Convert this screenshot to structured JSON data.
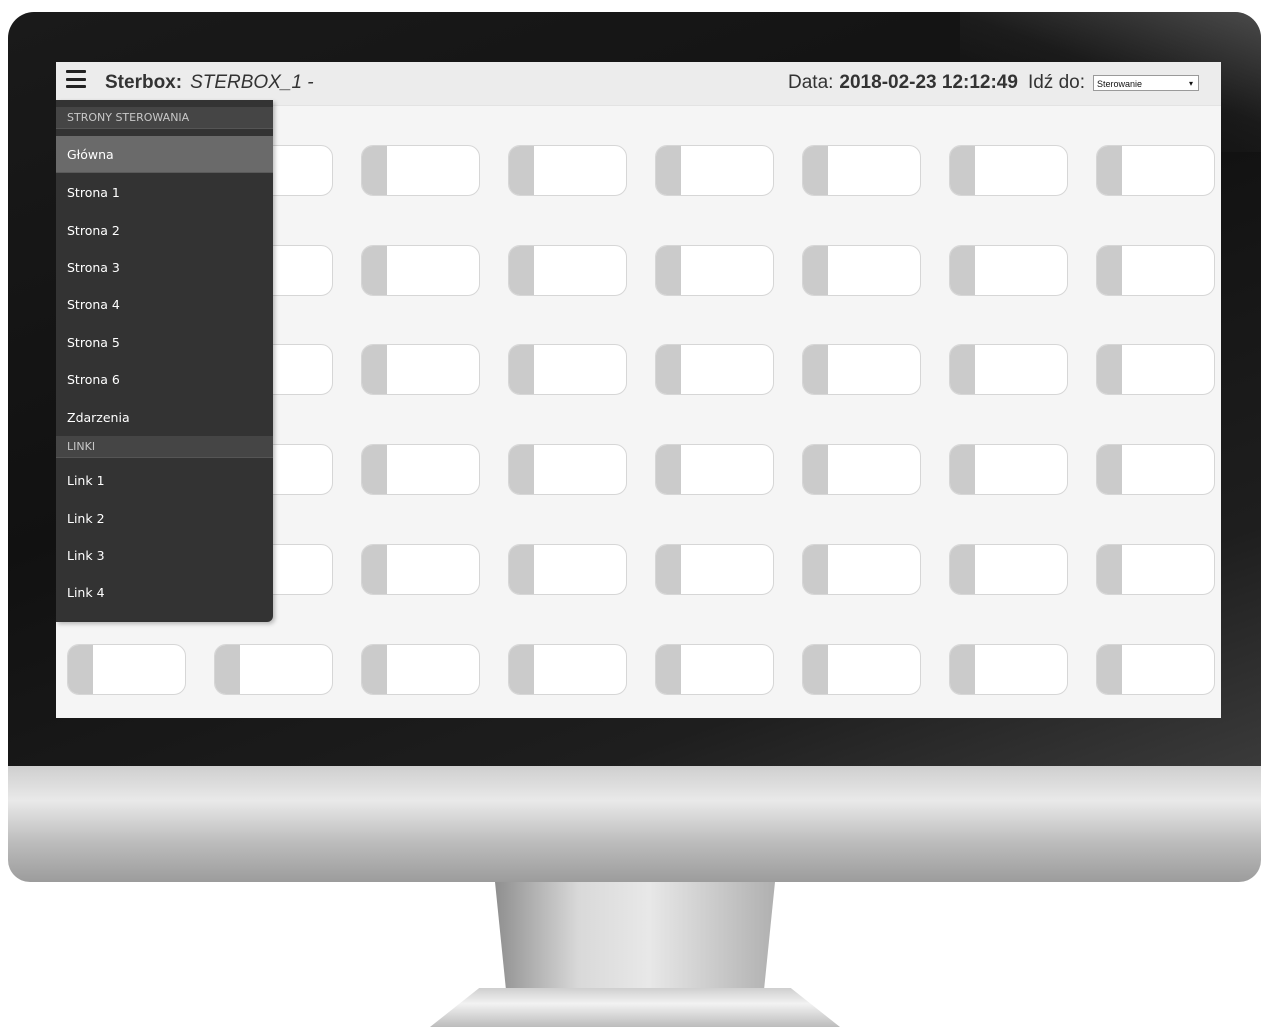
{
  "header": {
    "brand_label": "Sterbox:",
    "device_name": "STERBOX_1 -",
    "date_label": "Data:",
    "date_value": "2018-02-23 12:12:49",
    "goto_label": "Idź do:",
    "goto_selected": "Sterowanie"
  },
  "menu": {
    "section_pages": "STRONY STEROWANIA",
    "items": [
      {
        "label": "Główna",
        "active": true
      },
      {
        "label": "Strona 1"
      },
      {
        "label": "Strona 2"
      },
      {
        "label": "Strona 3"
      },
      {
        "label": "Strona 4"
      },
      {
        "label": "Strona 5"
      },
      {
        "label": "Strona 6"
      },
      {
        "label": "Zdarzenia"
      }
    ],
    "section_links": "LINKI",
    "links": [
      {
        "label": "Link 1"
      },
      {
        "label": "Link 2"
      },
      {
        "label": "Link 3"
      },
      {
        "label": "Link 4"
      }
    ]
  },
  "grid": {
    "rows": 6,
    "cols": 8
  },
  "colors": {
    "menu_bg": "#333333",
    "menu_active": "#6a6a6a",
    "tile_tab": "#cbcbcb",
    "screen_bg": "#f5f5f5"
  }
}
